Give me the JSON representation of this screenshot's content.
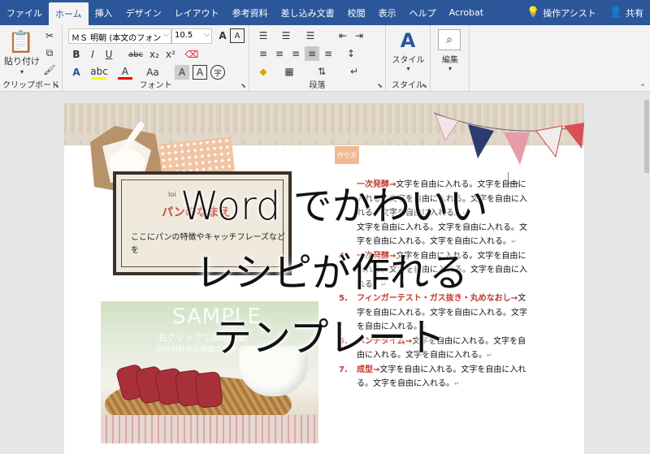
{
  "tabs": [
    {
      "label": "ファイル"
    },
    {
      "label": "ホーム",
      "active": true
    },
    {
      "label": "挿入"
    },
    {
      "label": "デザイン"
    },
    {
      "label": "レイアウト"
    },
    {
      "label": "参考資料"
    },
    {
      "label": "差し込み文書"
    },
    {
      "label": "校閲"
    },
    {
      "label": "表示"
    },
    {
      "label": "ヘルプ"
    },
    {
      "label": "Acrobat"
    }
  ],
  "tell_me": {
    "label": "操作アシスト",
    "icon": "lightbulb-icon"
  },
  "share": {
    "label": "共有",
    "icon": "person-icon"
  },
  "ribbon": {
    "clipboard": {
      "paste_label": "貼り付け",
      "group_label": "クリップボード"
    },
    "font": {
      "font_name": "ＭＳ 明朝 (本文のフォン",
      "font_size": "10.5",
      "group_label": "フォント",
      "bold": "B",
      "italic": "I",
      "underline": "U",
      "strike": "abc",
      "sub": "x₂",
      "sup": "x²",
      "grow": "A",
      "shrink": "A",
      "case": "Aa",
      "highlight": "A",
      "fontcolor": "A",
      "charshade": "A"
    },
    "paragraph": {
      "group_label": "段落"
    },
    "style": {
      "label": "スタイル",
      "group_label": "スタイル"
    },
    "editing": {
      "label": "編集"
    }
  },
  "document": {
    "tag_label": "作り方",
    "frame_small": "Ioi",
    "frame_title": "パンのなまえ",
    "frame_sub": "ここにパンの特徴やキャッチフレーズなどを",
    "photo_sample": "SAMPLE",
    "photo_line1": "右クリックで図の変更",
    "photo_line2": "自分の好きな画像に変更ください",
    "steps": [
      {
        "num": "",
        "head": "一次発酵→",
        "text": "文字を自由に入れる。文字を自由に入れる。文字を自由に入れる。文字を自由に入れる。文字を自由に入れる。"
      },
      {
        "num": "",
        "head": "",
        "text": "文字を自由に入れる。文字を自由に入れる。文字を自由に入れる。文字を自由に入れる。"
      },
      {
        "num": "4.",
        "head": "一次発酵→",
        "text": "文字を自由に入れる。文字を自由に入れる。文字を自由に入れる。文字を自由に入れる。"
      },
      {
        "num": "5.",
        "head": "フィンガーテスト・ガス抜き・丸めなおし→",
        "text": "文字を自由に入れる。文字を自由に入れる。文字を自由に入れる。"
      },
      {
        "num": "6.",
        "head": "ベンチタイム→",
        "text": "文字を自由に入れる。文字を自由に入れる。文字を自由に入れる。"
      },
      {
        "num": "7.",
        "head": "成型→",
        "text": "文字を自由に入れる。文字を自由に入れる。文字を自由に入れる。"
      }
    ]
  },
  "overlay": {
    "line1": "Word でかわいい",
    "line2": "レシピが作れる",
    "line3": "テンプレート"
  }
}
